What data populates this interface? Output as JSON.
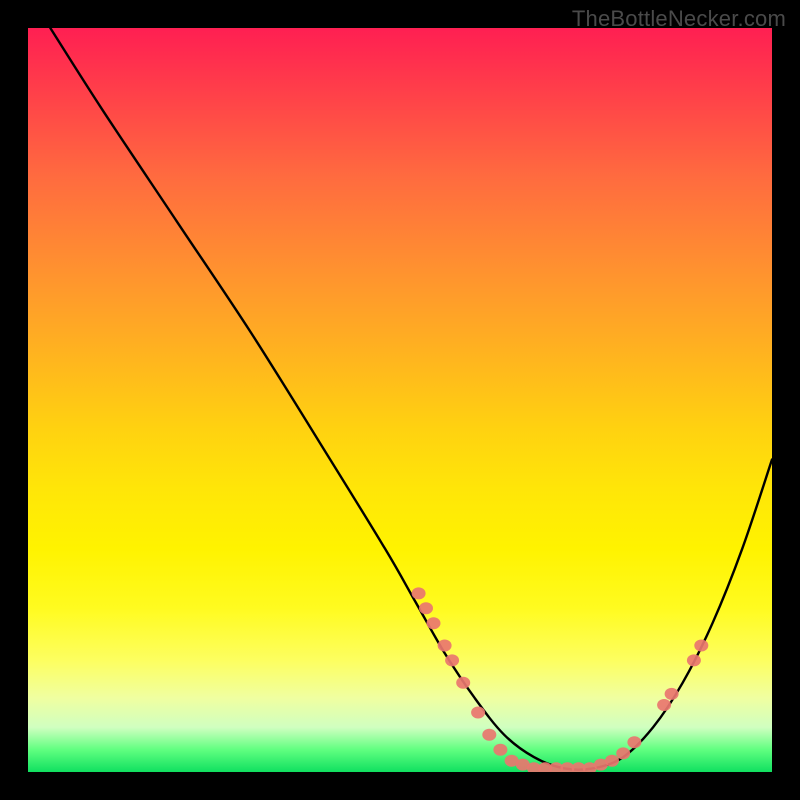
{
  "watermark": "TheBottleNecker.com",
  "chart_data": {
    "type": "line",
    "title": "",
    "xlabel": "",
    "ylabel": "",
    "xlim": [
      0,
      100
    ],
    "ylim": [
      0,
      100
    ],
    "series": [
      {
        "name": "curve",
        "x": [
          3,
          10,
          20,
          30,
          40,
          48,
          52,
          56,
          60,
          64,
          68,
          72,
          76,
          80,
          84,
          88,
          92,
          96,
          100
        ],
        "y": [
          100,
          89,
          74,
          59,
          43,
          30,
          23,
          16,
          10,
          5,
          2,
          0.5,
          0.5,
          2,
          6,
          12,
          20,
          30,
          42
        ]
      }
    ],
    "points": [
      {
        "x": 52.5,
        "y": 24
      },
      {
        "x": 53.5,
        "y": 22
      },
      {
        "x": 54.5,
        "y": 20
      },
      {
        "x": 56.0,
        "y": 17
      },
      {
        "x": 57.0,
        "y": 15
      },
      {
        "x": 58.5,
        "y": 12
      },
      {
        "x": 60.5,
        "y": 8
      },
      {
        "x": 62.0,
        "y": 5
      },
      {
        "x": 63.5,
        "y": 3
      },
      {
        "x": 65.0,
        "y": 1.5
      },
      {
        "x": 66.5,
        "y": 1
      },
      {
        "x": 68.0,
        "y": 0.5
      },
      {
        "x": 69.5,
        "y": 0.5
      },
      {
        "x": 71.0,
        "y": 0.5
      },
      {
        "x": 72.5,
        "y": 0.5
      },
      {
        "x": 74.0,
        "y": 0.5
      },
      {
        "x": 75.5,
        "y": 0.5
      },
      {
        "x": 77.0,
        "y": 1
      },
      {
        "x": 78.5,
        "y": 1.5
      },
      {
        "x": 80.0,
        "y": 2.5
      },
      {
        "x": 81.5,
        "y": 4
      },
      {
        "x": 85.5,
        "y": 9
      },
      {
        "x": 86.5,
        "y": 10.5
      },
      {
        "x": 89.5,
        "y": 15
      },
      {
        "x": 90.5,
        "y": 17
      }
    ],
    "gradient_stops": [
      {
        "pos": 0,
        "color": "#ff1f52"
      },
      {
        "pos": 50,
        "color": "#ffe000"
      },
      {
        "pos": 100,
        "color": "#10e060"
      }
    ]
  }
}
